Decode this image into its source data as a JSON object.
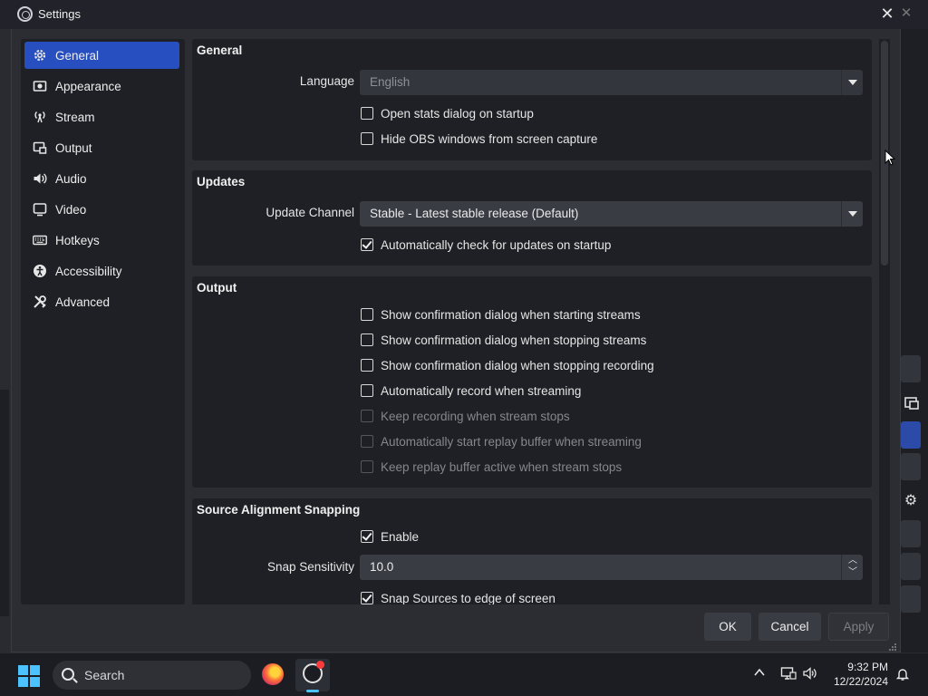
{
  "window": {
    "title": "Settings"
  },
  "sidebar": {
    "items": [
      {
        "label": "General",
        "icon": "gear-icon",
        "active": true
      },
      {
        "label": "Appearance",
        "icon": "appearance-icon"
      },
      {
        "label": "Stream",
        "icon": "broadcast-icon"
      },
      {
        "label": "Output",
        "icon": "output-icon"
      },
      {
        "label": "Audio",
        "icon": "speaker-icon"
      },
      {
        "label": "Video",
        "icon": "monitor-icon"
      },
      {
        "label": "Hotkeys",
        "icon": "keyboard-icon"
      },
      {
        "label": "Accessibility",
        "icon": "accessibility-icon"
      },
      {
        "label": "Advanced",
        "icon": "tools-icon"
      }
    ]
  },
  "general": {
    "title": "General",
    "language_label": "Language",
    "language_value": "English",
    "open_stats": {
      "label": "Open stats dialog on startup",
      "checked": false
    },
    "hide_obs": {
      "label": "Hide OBS windows from screen capture",
      "checked": false
    }
  },
  "updates": {
    "title": "Updates",
    "channel_label": "Update Channel",
    "channel_value": "Stable - Latest stable release (Default)",
    "auto_check": {
      "label": "Automatically check for updates on startup",
      "checked": true
    }
  },
  "output": {
    "title": "Output",
    "options": [
      {
        "label": "Show confirmation dialog when starting streams",
        "checked": false,
        "enabled": true
      },
      {
        "label": "Show confirmation dialog when stopping streams",
        "checked": false,
        "enabled": true
      },
      {
        "label": "Show confirmation dialog when stopping recording",
        "checked": false,
        "enabled": true
      },
      {
        "label": "Automatically record when streaming",
        "checked": false,
        "enabled": true
      },
      {
        "label": "Keep recording when stream stops",
        "checked": false,
        "enabled": false
      },
      {
        "label": "Automatically start replay buffer when streaming",
        "checked": false,
        "enabled": false
      },
      {
        "label": "Keep replay buffer active when stream stops",
        "checked": false,
        "enabled": false
      }
    ]
  },
  "snapping": {
    "title": "Source Alignment Snapping",
    "enable": {
      "label": "Enable",
      "checked": true
    },
    "sensitivity_label": "Snap Sensitivity",
    "sensitivity_value": "10.0",
    "snap_edge": {
      "label": "Snap Sources to edge of screen",
      "checked": true
    }
  },
  "footer": {
    "ok": "OK",
    "cancel": "Cancel",
    "apply": "Apply"
  },
  "taskbar": {
    "search_placeholder": "Search",
    "time": "9:32 PM",
    "date": "12/22/2024"
  },
  "colors": {
    "accent": "#284fbf",
    "panel": "#1f2025",
    "dialog": "#2b2d33"
  }
}
